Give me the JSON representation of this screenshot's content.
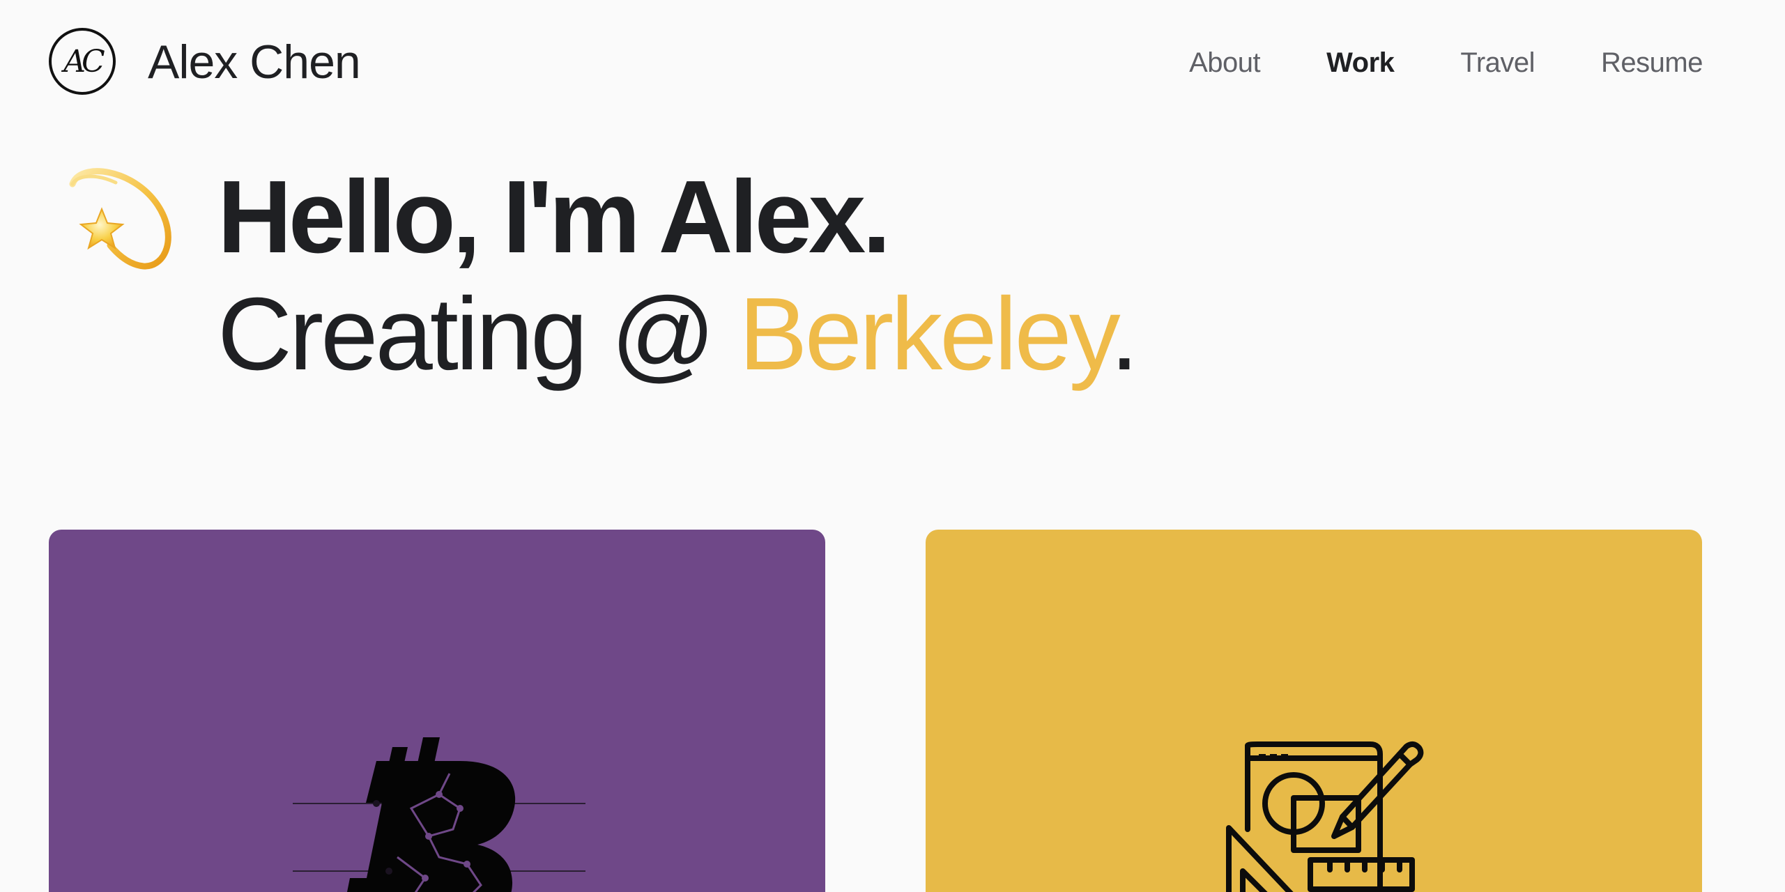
{
  "header": {
    "logo_text": "AC",
    "brand_name": "Alex Chen",
    "nav": [
      {
        "label": "About",
        "active": false
      },
      {
        "label": "Work",
        "active": true
      },
      {
        "label": "Travel",
        "active": false
      },
      {
        "label": "Resume",
        "active": false
      }
    ]
  },
  "hero": {
    "icon": "dizzy-star-icon",
    "line1": "Hello, I'm Alex.",
    "line2_prefix": "Creating @ ",
    "line2_accent": "Berkeley",
    "line2_suffix": "."
  },
  "projects": [
    {
      "name": "bitcoin-project",
      "icon": "bitcoin-circuit-icon",
      "background": "#6f4888"
    },
    {
      "name": "design-project",
      "icon": "design-tools-icon",
      "background": "#e7ba48"
    }
  ],
  "colors": {
    "accent": "#efbb49",
    "text": "#1f2023",
    "nav_inactive": "#5f6066",
    "page_background": "#fafafa"
  }
}
